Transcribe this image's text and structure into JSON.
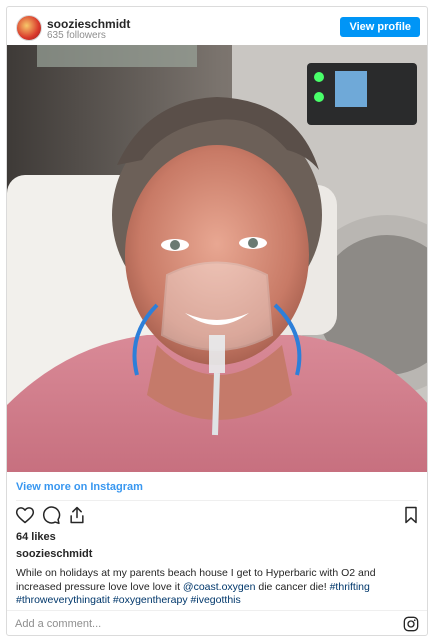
{
  "header": {
    "username": "soozieschmidt",
    "followers": "635 followers",
    "view_profile_label": "View profile"
  },
  "post": {
    "image_alt": "Woman smiling wearing an oxygen mask in a hyperbaric chamber",
    "view_more_label": "View more on Instagram",
    "likes": "64 likes",
    "caption_user": "soozieschmidt",
    "caption_text": "While on holidays at my parents beach house I get to Hyperbaric with O2 and increased pressure love love love it ",
    "caption_mention": "@coast.oxygen",
    "caption_mid": " die cancer die! ",
    "hashtags": [
      "#thrifting",
      "#throweverythingatit",
      "#oxygentherapy",
      "#ivegotthis"
    ]
  },
  "actions": {
    "like_icon": "heart-icon",
    "comment_icon": "comment-icon",
    "share_icon": "share-icon",
    "save_icon": "bookmark-icon"
  },
  "comment": {
    "placeholder": "Add a comment..."
  },
  "colors": {
    "accent": "#0095f6",
    "link": "#3897f0",
    "hashtag": "#00376b"
  }
}
